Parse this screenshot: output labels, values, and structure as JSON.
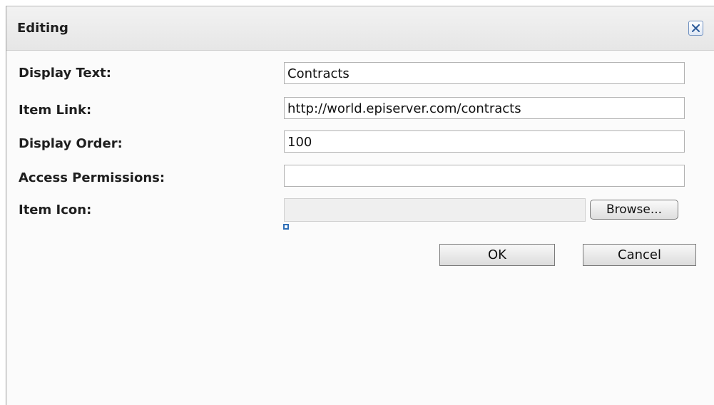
{
  "dialog": {
    "title": "Editing",
    "close_icon": "close-icon"
  },
  "fields": {
    "display_text": {
      "label": "Display Text:",
      "value": "Contracts"
    },
    "item_link": {
      "label": "Item Link:",
      "value": "http://world.episerver.com/contracts"
    },
    "display_order": {
      "label": "Display Order:",
      "value": "100"
    },
    "access_permissions": {
      "label": "Access Permissions:",
      "value": ""
    },
    "item_icon": {
      "label": "Item Icon:",
      "browse_label": "Browse..."
    }
  },
  "buttons": {
    "ok": "OK",
    "cancel": "Cancel"
  },
  "colors": {
    "close_accent": "#6d8fc0",
    "small_icon": "#2f6fb7"
  }
}
